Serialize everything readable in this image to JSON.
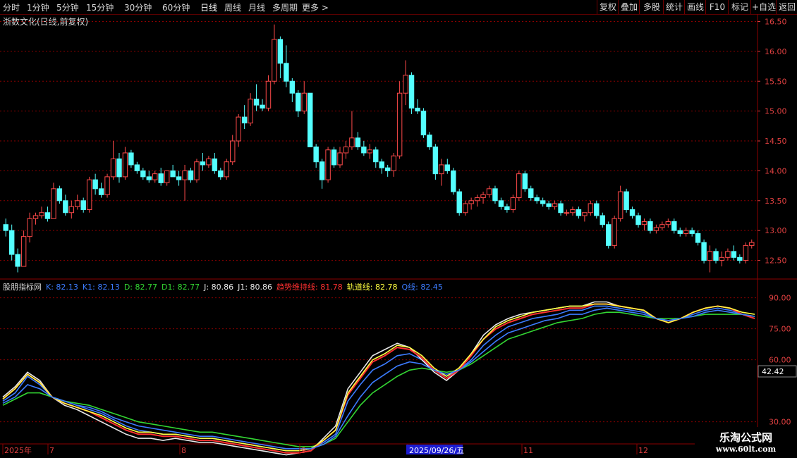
{
  "toolbar": {
    "periods": [
      "分时",
      "1分钟",
      "5分钟",
      "15分钟",
      "30分钟",
      "60分钟",
      "日线",
      "周线",
      "月线",
      "多周期",
      "更多 >"
    ],
    "active_period": "日线",
    "buttons": [
      "复权",
      "叠加",
      "多股",
      "统计",
      "画线",
      "F10",
      "标记",
      "+自选",
      "返回"
    ]
  },
  "stock_title": "浙数文化(日线,前复权)",
  "price_axis": [
    "16.50",
    "16.00",
    "15.50",
    "15.00",
    "14.50",
    "14.00",
    "13.50",
    "13.00",
    "12.50"
  ],
  "indicator": {
    "name": "股朋指标网",
    "legend": [
      {
        "label": "K: 82.13",
        "color": "#3c7cff"
      },
      {
        "label": "K1: 82.13",
        "color": "#3c7cff"
      },
      {
        "label": "D: 82.77",
        "color": "#33d633"
      },
      {
        "label": "D1: 82.77",
        "color": "#33d633"
      },
      {
        "label": "J: 80.86",
        "color": "#e8e8e8"
      },
      {
        "label": "J1: 80.86",
        "color": "#e8e8e8"
      },
      {
        "label": "趋势维持线: 81.78",
        "color": "#ff3030"
      },
      {
        "label": "轨道线: 82.78",
        "color": "#ffff40"
      },
      {
        "label": "Q线: 82.45",
        "color": "#3c7cff"
      }
    ],
    "axis": [
      "90.00",
      "75.00",
      "60.00",
      "30.00"
    ],
    "current_value_tag": "42.42"
  },
  "date_axis": [
    "2025年",
    "7",
    "8",
    "9",
    "2025/09/26/五",
    "11",
    "12"
  ],
  "watermark": {
    "line1": "乐淘公式网",
    "line2": "www.60lt.com"
  },
  "colors": {
    "up": "#ff4a4a",
    "down": "#54ffff",
    "grid": "#8b0000",
    "axis_text": "#e04040"
  },
  "chart_data": [
    {
      "type": "candlestick",
      "title": "浙数文化(日线,前复权)",
      "ylim": [
        12.2,
        16.6
      ],
      "ohlc": [
        [
          13.1,
          13.2,
          12.9,
          13.0
        ],
        [
          13.0,
          13.1,
          12.5,
          12.6
        ],
        [
          12.6,
          12.7,
          12.3,
          12.4
        ],
        [
          12.4,
          13.0,
          12.4,
          12.9
        ],
        [
          12.9,
          13.3,
          12.8,
          13.2
        ],
        [
          13.2,
          13.3,
          13.1,
          13.25
        ],
        [
          13.25,
          13.4,
          13.2,
          13.3
        ],
        [
          13.3,
          13.4,
          13.15,
          13.2
        ],
        [
          13.2,
          13.8,
          13.2,
          13.7
        ],
        [
          13.7,
          13.75,
          13.45,
          13.5
        ],
        [
          13.5,
          13.6,
          13.25,
          13.3
        ],
        [
          13.3,
          13.5,
          13.2,
          13.4
        ],
        [
          13.4,
          13.6,
          13.35,
          13.5
        ],
        [
          13.5,
          13.55,
          13.3,
          13.35
        ],
        [
          13.35,
          13.9,
          13.3,
          13.85
        ],
        [
          13.85,
          13.95,
          13.6,
          13.7
        ],
        [
          13.7,
          13.8,
          13.55,
          13.6
        ],
        [
          13.6,
          13.95,
          13.55,
          13.9
        ],
        [
          13.9,
          14.5,
          13.85,
          14.2
        ],
        [
          14.2,
          14.3,
          13.8,
          13.9
        ],
        [
          13.9,
          14.4,
          13.85,
          14.3
        ],
        [
          14.3,
          14.35,
          14.05,
          14.1
        ],
        [
          14.1,
          14.15,
          13.95,
          14.0
        ],
        [
          14.0,
          14.05,
          13.85,
          13.9
        ],
        [
          13.9,
          14.0,
          13.8,
          13.85
        ],
        [
          13.85,
          14.0,
          13.8,
          13.95
        ],
        [
          13.95,
          14.05,
          13.75,
          13.8
        ],
        [
          13.8,
          14.0,
          13.75,
          14.0
        ],
        [
          14.0,
          14.1,
          13.9,
          13.9
        ],
        [
          13.9,
          14.0,
          13.75,
          13.85
        ],
        [
          13.85,
          14.1,
          13.5,
          14.0
        ],
        [
          14.0,
          14.05,
          13.8,
          13.85
        ],
        [
          13.85,
          14.2,
          13.8,
          14.15
        ],
        [
          14.15,
          14.3,
          14.0,
          14.1
        ],
        [
          14.1,
          14.25,
          14.05,
          14.2
        ],
        [
          14.2,
          14.3,
          13.95,
          14.0
        ],
        [
          14.0,
          14.05,
          13.85,
          13.9
        ],
        [
          13.9,
          14.2,
          13.85,
          14.15
        ],
        [
          14.15,
          14.6,
          14.1,
          14.5
        ],
        [
          14.5,
          14.95,
          14.4,
          14.9
        ],
        [
          14.9,
          15.1,
          14.7,
          14.8
        ],
        [
          14.8,
          15.3,
          14.75,
          15.2
        ],
        [
          15.2,
          15.45,
          15.0,
          15.1
        ],
        [
          15.1,
          15.2,
          15.0,
          15.05
        ],
        [
          15.05,
          15.6,
          15.0,
          15.5
        ],
        [
          15.5,
          16.45,
          15.45,
          16.2
        ],
        [
          16.2,
          16.25,
          15.55,
          15.8
        ],
        [
          15.8,
          16.1,
          15.4,
          15.5
        ],
        [
          15.5,
          15.55,
          15.15,
          15.3
        ],
        [
          15.3,
          15.35,
          14.9,
          15.0
        ],
        [
          15.0,
          15.5,
          14.95,
          15.3
        ],
        [
          15.3,
          15.3,
          14.6,
          14.4
        ],
        [
          14.4,
          14.45,
          14.05,
          14.15
        ],
        [
          14.15,
          14.2,
          13.7,
          13.85
        ],
        [
          13.85,
          14.4,
          13.8,
          14.35
        ],
        [
          14.35,
          14.4,
          14.05,
          14.1
        ],
        [
          14.1,
          14.4,
          14.05,
          14.3
        ],
        [
          14.3,
          14.5,
          14.2,
          14.4
        ],
        [
          14.4,
          15.0,
          14.35,
          14.55
        ],
        [
          14.55,
          14.65,
          14.35,
          14.4
        ],
        [
          14.4,
          14.5,
          14.25,
          14.3
        ],
        [
          14.3,
          14.45,
          14.2,
          14.35
        ],
        [
          14.35,
          14.4,
          14.05,
          14.15
        ],
        [
          14.15,
          14.2,
          13.95,
          14.05
        ],
        [
          14.05,
          14.1,
          13.9,
          14.0
        ],
        [
          14.0,
          14.3,
          13.9,
          14.25
        ],
        [
          14.25,
          15.5,
          14.2,
          15.3
        ],
        [
          15.3,
          15.85,
          15.1,
          15.6
        ],
        [
          15.6,
          15.65,
          14.95,
          15.05
        ],
        [
          15.05,
          15.2,
          14.95,
          15.0
        ],
        [
          15.0,
          15.05,
          14.55,
          14.6
        ],
        [
          14.6,
          14.65,
          14.35,
          14.4
        ],
        [
          14.4,
          14.45,
          13.85,
          13.95
        ],
        [
          13.95,
          14.2,
          13.75,
          14.1
        ],
        [
          14.1,
          14.2,
          13.95,
          14.0
        ],
        [
          14.0,
          14.05,
          13.6,
          13.65
        ],
        [
          13.65,
          13.7,
          13.25,
          13.3
        ],
        [
          13.3,
          13.5,
          13.25,
          13.45
        ],
        [
          13.45,
          13.55,
          13.35,
          13.5
        ],
        [
          13.5,
          13.6,
          13.4,
          13.55
        ],
        [
          13.55,
          13.65,
          13.45,
          13.6
        ],
        [
          13.6,
          13.75,
          13.55,
          13.7
        ],
        [
          13.7,
          13.75,
          13.45,
          13.5
        ],
        [
          13.5,
          13.55,
          13.35,
          13.4
        ],
        [
          13.4,
          13.45,
          13.3,
          13.35
        ],
        [
          13.35,
          13.6,
          13.3,
          13.55
        ],
        [
          13.55,
          14.0,
          13.5,
          13.95
        ],
        [
          13.95,
          14.0,
          13.65,
          13.7
        ],
        [
          13.7,
          13.75,
          13.5,
          13.55
        ],
        [
          13.55,
          13.6,
          13.45,
          13.5
        ],
        [
          13.5,
          13.55,
          13.4,
          13.45
        ],
        [
          13.45,
          13.5,
          13.35,
          13.4
        ],
        [
          13.4,
          13.5,
          13.35,
          13.45
        ],
        [
          13.45,
          13.5,
          13.25,
          13.3
        ],
        [
          13.3,
          13.35,
          13.25,
          13.3
        ],
        [
          13.3,
          13.4,
          13.25,
          13.35
        ],
        [
          13.35,
          13.4,
          13.2,
          13.25
        ],
        [
          13.25,
          13.3,
          13.15,
          13.3
        ],
        [
          13.3,
          13.5,
          13.25,
          13.45
        ],
        [
          13.45,
          13.5,
          13.2,
          13.25
        ],
        [
          13.25,
          13.3,
          13.05,
          13.1
        ],
        [
          13.1,
          13.15,
          12.7,
          12.75
        ],
        [
          12.75,
          13.25,
          12.7,
          13.2
        ],
        [
          13.2,
          13.75,
          13.15,
          13.65
        ],
        [
          13.65,
          13.7,
          13.3,
          13.35
        ],
        [
          13.35,
          13.4,
          13.2,
          13.25
        ],
        [
          13.25,
          13.3,
          13.05,
          13.1
        ],
        [
          13.1,
          13.2,
          13.0,
          13.15
        ],
        [
          13.15,
          13.2,
          12.95,
          13.0
        ],
        [
          13.0,
          13.1,
          12.95,
          13.05
        ],
        [
          13.05,
          13.15,
          13.0,
          13.1
        ],
        [
          13.1,
          13.2,
          13.05,
          13.15
        ],
        [
          13.15,
          13.2,
          12.95,
          13.0
        ],
        [
          13.0,
          13.05,
          12.9,
          12.95
        ],
        [
          12.95,
          13.05,
          12.9,
          13.0
        ],
        [
          13.0,
          13.05,
          12.9,
          12.95
        ],
        [
          12.95,
          13.0,
          12.75,
          12.8
        ],
        [
          12.8,
          12.85,
          12.45,
          12.5
        ],
        [
          12.5,
          12.75,
          12.3,
          12.65
        ],
        [
          12.65,
          12.7,
          12.45,
          12.5
        ],
        [
          12.5,
          12.65,
          12.4,
          12.55
        ],
        [
          12.55,
          12.7,
          12.5,
          12.65
        ],
        [
          12.65,
          12.75,
          12.5,
          12.55
        ],
        [
          12.55,
          12.6,
          12.45,
          12.5
        ],
        [
          12.5,
          12.8,
          12.45,
          12.75
        ],
        [
          12.75,
          12.85,
          12.7,
          12.8
        ]
      ]
    },
    {
      "type": "line",
      "title": "股朋指标网",
      "ylim": [
        20,
        95
      ],
      "series": [
        {
          "name": "K",
          "color": "#3c7cff",
          "values": [
            40,
            44,
            52,
            48,
            42,
            40,
            38,
            36,
            34,
            31,
            28,
            26,
            25,
            24,
            24,
            23,
            22,
            22,
            21,
            20,
            19,
            18,
            17,
            16,
            16,
            17,
            20,
            24,
            40,
            48,
            55,
            58,
            62,
            63,
            60,
            55,
            52,
            55,
            60,
            67,
            72,
            76,
            78,
            80,
            81,
            82,
            84,
            84,
            86,
            86,
            85,
            84,
            83,
            80,
            79,
            80,
            82,
            84,
            85,
            84,
            82,
            80
          ]
        },
        {
          "name": "D",
          "color": "#33d633",
          "values": [
            38,
            41,
            44,
            44,
            42,
            40,
            39,
            38,
            36,
            34,
            32,
            30,
            29,
            28,
            27,
            26,
            25,
            25,
            24,
            23,
            22,
            21,
            20,
            19,
            18,
            18,
            19,
            22,
            30,
            38,
            44,
            48,
            52,
            55,
            56,
            55,
            54,
            55,
            58,
            62,
            66,
            70,
            72,
            74,
            76,
            78,
            79,
            80,
            82,
            83,
            83,
            82,
            81,
            80,
            80,
            80,
            81,
            82,
            82,
            82,
            82,
            81
          ]
        },
        {
          "name": "J",
          "color": "#e8e8e8",
          "values": [
            42,
            47,
            54,
            50,
            42,
            38,
            36,
            33,
            30,
            27,
            24,
            22,
            22,
            21,
            22,
            21,
            20,
            20,
            19,
            18,
            17,
            16,
            15,
            14,
            15,
            16,
            22,
            28,
            46,
            54,
            62,
            65,
            68,
            66,
            60,
            54,
            50,
            55,
            63,
            72,
            77,
            80,
            82,
            83,
            84,
            85,
            86,
            86,
            88,
            88,
            86,
            85,
            84,
            80,
            78,
            80,
            83,
            85,
            86,
            85,
            82,
            80
          ]
        },
        {
          "name": "趋势维持线",
          "color": "#ff3030",
          "values": [
            41,
            46,
            53,
            49,
            42,
            39,
            37,
            35,
            32,
            29,
            26,
            24,
            24,
            23,
            23,
            22,
            21,
            21,
            20,
            19,
            18,
            17,
            16,
            15,
            15,
            16,
            21,
            26,
            43,
            51,
            59,
            62,
            66,
            65,
            61,
            55,
            51,
            55,
            62,
            70,
            75,
            78,
            80,
            82,
            83,
            84,
            85,
            85,
            87,
            87,
            86,
            85,
            84,
            80,
            78,
            80,
            83,
            85,
            86,
            85,
            82,
            80
          ]
        },
        {
          "name": "轨道线",
          "color": "#ffff40",
          "values": [
            41,
            46,
            53,
            49,
            42,
            39,
            37,
            35,
            33,
            30,
            27,
            25,
            25,
            24,
            24,
            23,
            22,
            22,
            21,
            20,
            19,
            18,
            17,
            16,
            16,
            17,
            21,
            26,
            44,
            52,
            60,
            63,
            67,
            66,
            62,
            56,
            52,
            56,
            63,
            70,
            76,
            79,
            81,
            83,
            84,
            85,
            86,
            86,
            87,
            87,
            86,
            85,
            84,
            80,
            78,
            80,
            83,
            85,
            86,
            85,
            83,
            82
          ]
        },
        {
          "name": "Q线",
          "color": "#3c7cff",
          "values": [
            39,
            42,
            48,
            46,
            42,
            40,
            38,
            37,
            35,
            32,
            30,
            28,
            27,
            26,
            25,
            24,
            23,
            23,
            22,
            21,
            20,
            19,
            18,
            17,
            17,
            17,
            19,
            23,
            33,
            42,
            49,
            53,
            57,
            59,
            58,
            55,
            53,
            55,
            59,
            64,
            69,
            73,
            75,
            77,
            79,
            80,
            82,
            82,
            84,
            85,
            84,
            83,
            82,
            80,
            79,
            80,
            81,
            83,
            84,
            83,
            82,
            81
          ]
        }
      ]
    }
  ]
}
